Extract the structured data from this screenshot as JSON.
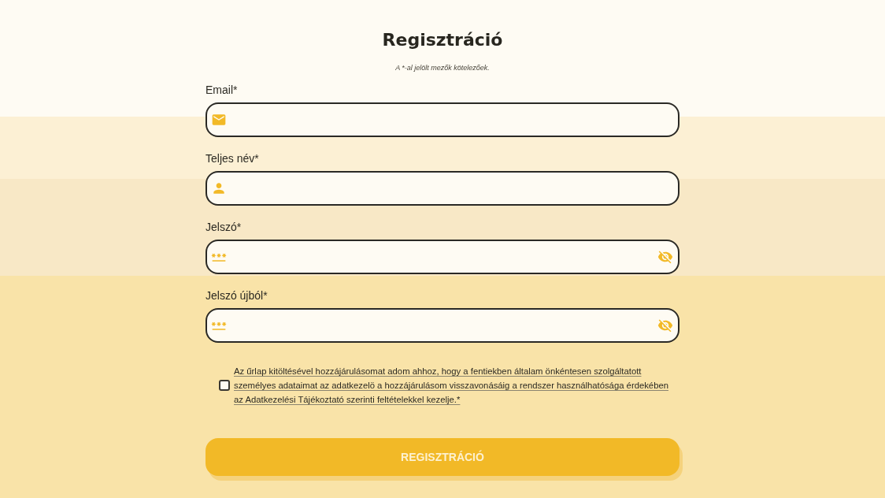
{
  "title": "Regisztráció",
  "subtitle": "A *-al jelölt mezők kötelezőek.",
  "fields": [
    {
      "kind": "email",
      "label": "Email*"
    },
    {
      "kind": "name",
      "label": "Teljes név*"
    },
    {
      "kind": "password",
      "label": "Jelszó*",
      "password_visible": false
    },
    {
      "kind": "password",
      "label": "Jelszó újból*",
      "password_visible": false
    }
  ],
  "consent": {
    "checked": false,
    "text": "Az űrlap kitöltésével hozzájárulásomat adom ahhoz, hogy a fentiekben általam önkéntesen szolgáltatott személyes adataimat az adatkezelö a hozzájárulásom visszavonásáig a rendszer használhatósága érdekében az Adatkezelési Tájékoztató szerinti feltételekkel kezelje.*"
  },
  "submit_button": {
    "label": "REGISZTRÁCIÓ"
  }
}
